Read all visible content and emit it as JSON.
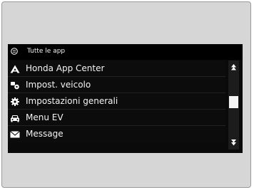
{
  "header": {
    "title": "Tutte le app",
    "icon": "apps-grid-icon"
  },
  "list": {
    "items": [
      {
        "label": "Honda App Center",
        "icon": "honda-app-center-icon"
      },
      {
        "label": "Impost. veicolo",
        "icon": "vehicle-settings-icon"
      },
      {
        "label": "Impostazioni generali",
        "icon": "gear-icon"
      },
      {
        "label": "Menu EV",
        "icon": "car-icon"
      },
      {
        "label": "Message",
        "icon": "envelope-icon"
      }
    ]
  },
  "scrollbar": {
    "up_icon": "scroll-up-icon",
    "down_icon": "scroll-down-icon"
  },
  "colors": {
    "screen_bg": "#0a0a0a",
    "text": "#ffffff",
    "frame_bg": "#d6d6d6"
  }
}
